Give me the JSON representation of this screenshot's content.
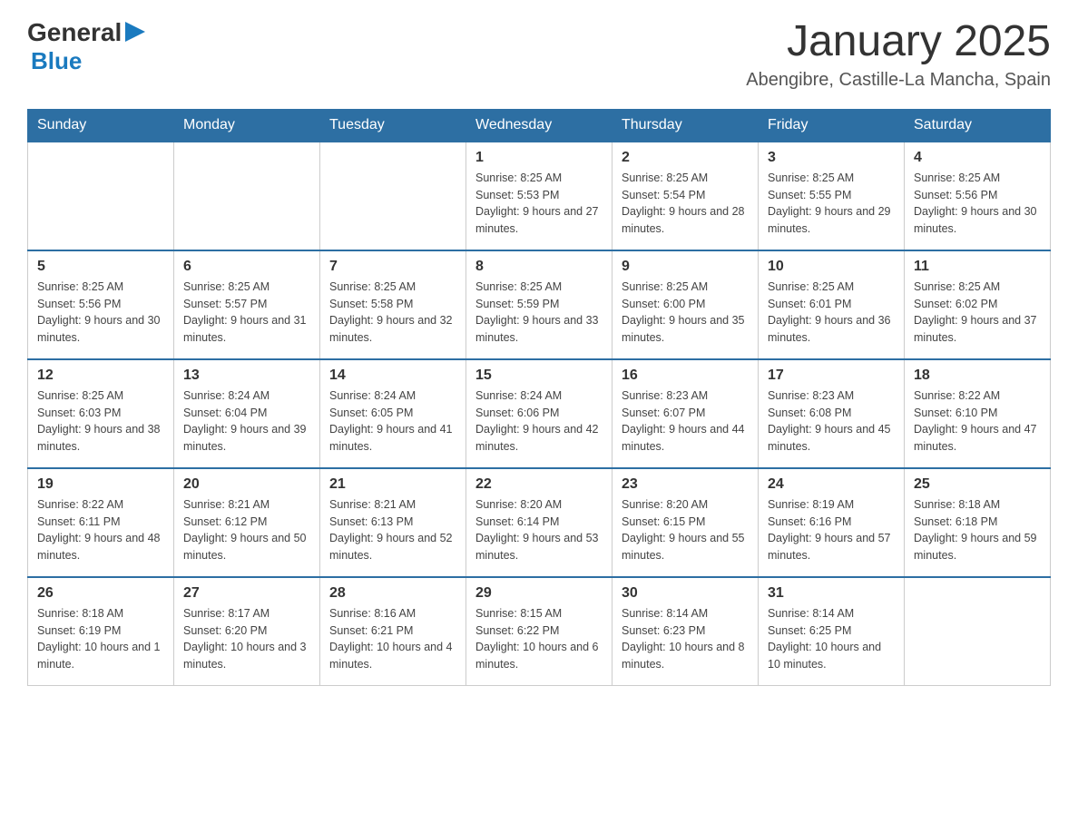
{
  "header": {
    "logo": {
      "general": "General",
      "blue": "Blue"
    },
    "title": "January 2025",
    "location": "Abengibre, Castille-La Mancha, Spain"
  },
  "calendar": {
    "days_of_week": [
      "Sunday",
      "Monday",
      "Tuesday",
      "Wednesday",
      "Thursday",
      "Friday",
      "Saturday"
    ],
    "weeks": [
      [
        {
          "day": "",
          "info": ""
        },
        {
          "day": "",
          "info": ""
        },
        {
          "day": "",
          "info": ""
        },
        {
          "day": "1",
          "info": "Sunrise: 8:25 AM\nSunset: 5:53 PM\nDaylight: 9 hours and 27 minutes."
        },
        {
          "day": "2",
          "info": "Sunrise: 8:25 AM\nSunset: 5:54 PM\nDaylight: 9 hours and 28 minutes."
        },
        {
          "day": "3",
          "info": "Sunrise: 8:25 AM\nSunset: 5:55 PM\nDaylight: 9 hours and 29 minutes."
        },
        {
          "day": "4",
          "info": "Sunrise: 8:25 AM\nSunset: 5:56 PM\nDaylight: 9 hours and 30 minutes."
        }
      ],
      [
        {
          "day": "5",
          "info": "Sunrise: 8:25 AM\nSunset: 5:56 PM\nDaylight: 9 hours and 30 minutes."
        },
        {
          "day": "6",
          "info": "Sunrise: 8:25 AM\nSunset: 5:57 PM\nDaylight: 9 hours and 31 minutes."
        },
        {
          "day": "7",
          "info": "Sunrise: 8:25 AM\nSunset: 5:58 PM\nDaylight: 9 hours and 32 minutes."
        },
        {
          "day": "8",
          "info": "Sunrise: 8:25 AM\nSunset: 5:59 PM\nDaylight: 9 hours and 33 minutes."
        },
        {
          "day": "9",
          "info": "Sunrise: 8:25 AM\nSunset: 6:00 PM\nDaylight: 9 hours and 35 minutes."
        },
        {
          "day": "10",
          "info": "Sunrise: 8:25 AM\nSunset: 6:01 PM\nDaylight: 9 hours and 36 minutes."
        },
        {
          "day": "11",
          "info": "Sunrise: 8:25 AM\nSunset: 6:02 PM\nDaylight: 9 hours and 37 minutes."
        }
      ],
      [
        {
          "day": "12",
          "info": "Sunrise: 8:25 AM\nSunset: 6:03 PM\nDaylight: 9 hours and 38 minutes."
        },
        {
          "day": "13",
          "info": "Sunrise: 8:24 AM\nSunset: 6:04 PM\nDaylight: 9 hours and 39 minutes."
        },
        {
          "day": "14",
          "info": "Sunrise: 8:24 AM\nSunset: 6:05 PM\nDaylight: 9 hours and 41 minutes."
        },
        {
          "day": "15",
          "info": "Sunrise: 8:24 AM\nSunset: 6:06 PM\nDaylight: 9 hours and 42 minutes."
        },
        {
          "day": "16",
          "info": "Sunrise: 8:23 AM\nSunset: 6:07 PM\nDaylight: 9 hours and 44 minutes."
        },
        {
          "day": "17",
          "info": "Sunrise: 8:23 AM\nSunset: 6:08 PM\nDaylight: 9 hours and 45 minutes."
        },
        {
          "day": "18",
          "info": "Sunrise: 8:22 AM\nSunset: 6:10 PM\nDaylight: 9 hours and 47 minutes."
        }
      ],
      [
        {
          "day": "19",
          "info": "Sunrise: 8:22 AM\nSunset: 6:11 PM\nDaylight: 9 hours and 48 minutes."
        },
        {
          "day": "20",
          "info": "Sunrise: 8:21 AM\nSunset: 6:12 PM\nDaylight: 9 hours and 50 minutes."
        },
        {
          "day": "21",
          "info": "Sunrise: 8:21 AM\nSunset: 6:13 PM\nDaylight: 9 hours and 52 minutes."
        },
        {
          "day": "22",
          "info": "Sunrise: 8:20 AM\nSunset: 6:14 PM\nDaylight: 9 hours and 53 minutes."
        },
        {
          "day": "23",
          "info": "Sunrise: 8:20 AM\nSunset: 6:15 PM\nDaylight: 9 hours and 55 minutes."
        },
        {
          "day": "24",
          "info": "Sunrise: 8:19 AM\nSunset: 6:16 PM\nDaylight: 9 hours and 57 minutes."
        },
        {
          "day": "25",
          "info": "Sunrise: 8:18 AM\nSunset: 6:18 PM\nDaylight: 9 hours and 59 minutes."
        }
      ],
      [
        {
          "day": "26",
          "info": "Sunrise: 8:18 AM\nSunset: 6:19 PM\nDaylight: 10 hours and 1 minute."
        },
        {
          "day": "27",
          "info": "Sunrise: 8:17 AM\nSunset: 6:20 PM\nDaylight: 10 hours and 3 minutes."
        },
        {
          "day": "28",
          "info": "Sunrise: 8:16 AM\nSunset: 6:21 PM\nDaylight: 10 hours and 4 minutes."
        },
        {
          "day": "29",
          "info": "Sunrise: 8:15 AM\nSunset: 6:22 PM\nDaylight: 10 hours and 6 minutes."
        },
        {
          "day": "30",
          "info": "Sunrise: 8:14 AM\nSunset: 6:23 PM\nDaylight: 10 hours and 8 minutes."
        },
        {
          "day": "31",
          "info": "Sunrise: 8:14 AM\nSunset: 6:25 PM\nDaylight: 10 hours and 10 minutes."
        },
        {
          "day": "",
          "info": ""
        }
      ]
    ]
  }
}
